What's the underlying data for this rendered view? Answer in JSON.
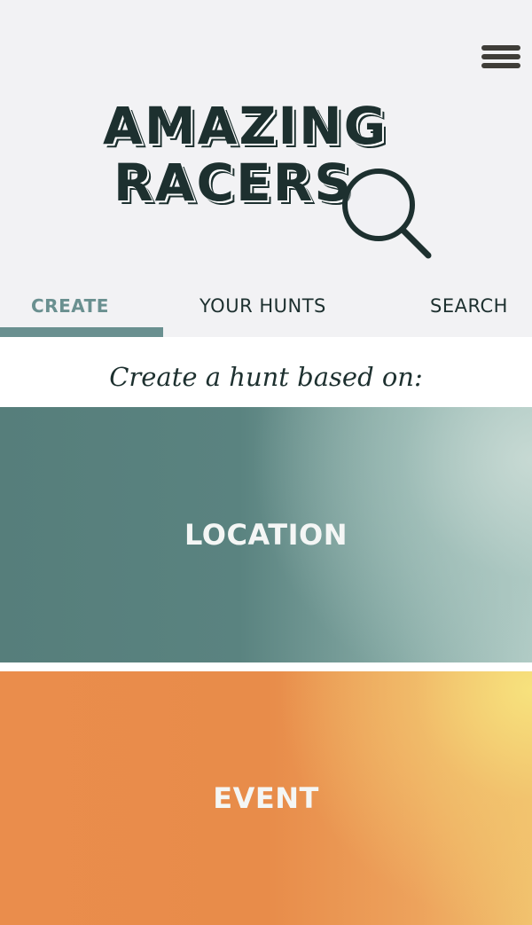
{
  "header": {
    "logo_line_1": "AMAZING",
    "logo_line_2": "RACERS",
    "menu_icon": "hamburger-menu-icon",
    "logo_icon": "magnifying-glass-icon"
  },
  "tabs": [
    {
      "label": "CREATE",
      "active": true
    },
    {
      "label": "YOUR HUNTS",
      "active": false
    },
    {
      "label": "SEARCH",
      "active": false
    }
  ],
  "main": {
    "prompt": "Create a hunt based on:",
    "options": [
      {
        "label": "LOCATION"
      },
      {
        "label": "EVENT"
      }
    ]
  },
  "colors": {
    "header_bg": "#f2f2f4",
    "text_dark": "#1d302f",
    "accent_teal": "#6a9090",
    "location_start": "#567e7b",
    "location_end": "#b3cdc7",
    "event_start": "#ea8d4c",
    "event_end": "#f7e27d"
  }
}
